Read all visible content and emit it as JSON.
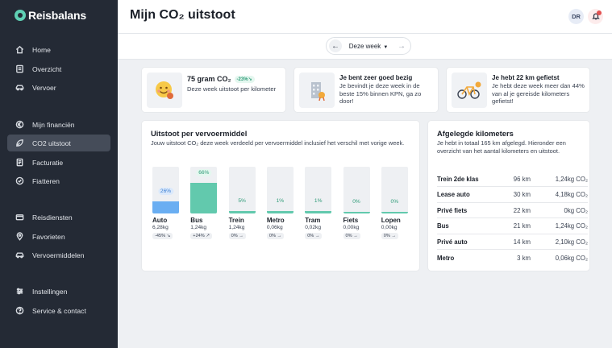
{
  "app": {
    "logo_text": "Reisbalans"
  },
  "sidebar": {
    "items": [
      {
        "label": "Home",
        "icon": "home-icon"
      },
      {
        "label": "Overzicht",
        "icon": "list-icon"
      },
      {
        "label": "Vervoer",
        "icon": "car-icon"
      },
      {
        "label": "Mijn financiën",
        "icon": "euro-icon"
      },
      {
        "label": "CO2 uitstoot",
        "icon": "leaf-icon",
        "active": true
      },
      {
        "label": "Facturatie",
        "icon": "invoice-icon"
      },
      {
        "label": "Fiatteren",
        "icon": "check-circle-icon"
      },
      {
        "label": "Reisdiensten",
        "icon": "card-icon"
      },
      {
        "label": "Favorieten",
        "icon": "pin-icon"
      },
      {
        "label": "Vervoermiddelen",
        "icon": "car-icon"
      },
      {
        "label": "Instellingen",
        "icon": "sliders-icon"
      },
      {
        "label": "Service & contact",
        "icon": "help-icon"
      }
    ]
  },
  "header": {
    "title": "Mijn CO₂ uitstoot",
    "avatar_initials": "DR"
  },
  "week_selector": {
    "label": "Deze week"
  },
  "info_cards": [
    {
      "title": "75 gram CO₂",
      "badge": "-23%↘",
      "desc": "Deze week uitstoot per kilometer"
    },
    {
      "title": "Je bent zeer goed bezig",
      "desc": "Je bevindt je deze week in de beste 15% binnen KPN, ga zo door!"
    },
    {
      "title": "Je hebt 22 km gefietst",
      "desc": "Je hebt deze week meer dan 44% van al je gereisde kilometers gefietst!"
    }
  ],
  "chart_card": {
    "title": "Uitstoot per vervoermiddel",
    "subtitle": "Jouw uitstoot CO₂ deze week verdeeld per vervoermiddel inclusief het verschil met vorige week."
  },
  "chart_data": {
    "type": "bar",
    "categories": [
      "Auto",
      "Bus",
      "Trein",
      "Metro",
      "Tram",
      "Fiets",
      "Lopen"
    ],
    "values": [
      26,
      66,
      5,
      1,
      1,
      0,
      0
    ],
    "value_labels": [
      "26%",
      "66%",
      "5%",
      "1%",
      "1%",
      "0%",
      "0%"
    ],
    "amounts": [
      "6,28kg",
      "1,24kg",
      "1,24kg",
      "0,06kg",
      "0,02kg",
      "0,00kg",
      "0,00kg"
    ],
    "deltas": [
      "-45% ↘",
      "+24% ↗",
      "0% →",
      "0% →",
      "0% →",
      "0% →",
      "0% →"
    ],
    "ylim": [
      0,
      100
    ],
    "colors": {
      "Auto": "#6aaef2",
      "default": "#62c9ad"
    }
  },
  "km_card": {
    "title": "Afgelegde kilometers",
    "subtitle": "Je hebt in totaal 165 km afgelegd. Hieronder een overzicht van het aantal kilometers en uitstoot.",
    "rows": [
      {
        "mode": "Trein 2de klas",
        "km": "96 km",
        "co2": "1,24kg CO₂"
      },
      {
        "mode": "Lease auto",
        "km": "30 km",
        "co2": "4,18kg CO₂"
      },
      {
        "mode": "Privé fiets",
        "km": "22 km",
        "co2": "0kg CO₂"
      },
      {
        "mode": "Bus",
        "km": "21 km",
        "co2": "1,24kg CO₂"
      },
      {
        "mode": "Privé auto",
        "km": "14 km",
        "co2": "2,10kg CO₂"
      },
      {
        "mode": "Metro",
        "km": "3 km",
        "co2": "0,06kg CO₂"
      }
    ]
  }
}
